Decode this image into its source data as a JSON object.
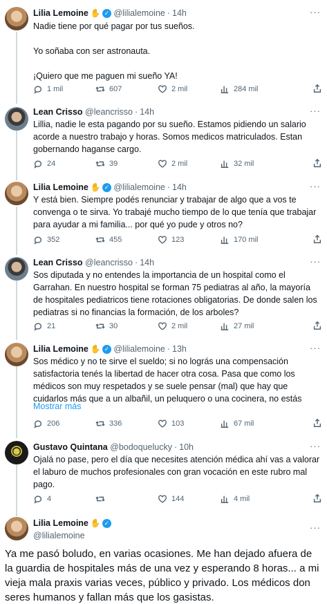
{
  "tweets": [
    {
      "name": "Lilia Lemoine",
      "handle": "@lilialemoine",
      "time": "14h",
      "text": "Nadie tiene por qué pagar por tus sueños.\n\nYo soñaba con ser astronauta.\n\n¡Quiero que me paguen mi sueño YA!",
      "replies": "1 mil",
      "retweets": "607",
      "likes": "2 mil",
      "views": "284 mil"
    },
    {
      "name": "Lean Crisso",
      "handle": "@leancrisso",
      "time": "14h",
      "text": "Lillia, nadie le esta pagando por su sueño. Estamos pidiendo un salario acorde a nuestro trabajo y horas. Somos medicos matriculados. Estan gobernando haganse cargo.",
      "replies": "24",
      "retweets": "39",
      "likes": "2 mil",
      "views": "32 mil"
    },
    {
      "name": "Lilia Lemoine",
      "handle": "@lilialemoine",
      "time": "14h",
      "text": "Y está bien. Siempre podés renunciar y trabajar de algo que a vos te convenga o te sirva. Yo trabajé mucho tiempo de lo que tenía que trabajar para ayudar a mi familia... por qué yo pude y otros no?",
      "replies": "352",
      "retweets": "455",
      "likes": "123",
      "views": "170 mil"
    },
    {
      "name": "Lean Crisso",
      "handle": "@leancrisso",
      "time": "14h",
      "text": "Sos diputada y no entendes la importancia de un hospital como el Garrahan. En nuestro hospital se forman 75 pediatras al año, la mayoría de hospitales pediatricos tiene rotaciones obligatorias. De donde salen los pediatras si no financias la formación, de los arboles?",
      "replies": "21",
      "retweets": "30",
      "likes": "2 mil",
      "views": "27 mil"
    },
    {
      "name": "Lilia Lemoine",
      "handle": "@lilialemoine",
      "time": "13h",
      "text": "Sos médico y no te sirve el sueldo; si no lográs una compensación satisfactoria tenés la libertad de hacer otra cosa. Pasa que como los médicos son muy respetados y se suele pensar (mal) que hay que cuidarlos más que a un albañil, un peluquero o una cocinera, no estás",
      "show_more": "Mostrar más",
      "replies": "206",
      "retweets": "336",
      "likes": "103",
      "views": "67 mil"
    },
    {
      "name": "Gustavo Quintana",
      "handle": "@bodoquelucky",
      "time": "10h",
      "text": "Ojalá no pase, pero el día que necesites atención médica ahí vas a valorar el laburo de muchos profesionales con gran vocación en este rubro mal pago.",
      "replies": "4",
      "retweets": "",
      "likes": "144",
      "views": "4 mil"
    }
  ],
  "main_tweet": {
    "name": "Lilia Lemoine",
    "handle": "@lilialemoine",
    "text": "Ya me pasó boludo, en varias ocasiones. Me han dejado afuera de la guardia de hospitales más de una vez y esperando 8 horas... a mi vieja mala praxis varias veces, público y privado. Los médicos don seres humanos y fallan más que los gasistas."
  },
  "separator": "·",
  "more_glyph": "···",
  "colors": {
    "accent": "#1d9bf0",
    "muted": "#536471",
    "text": "#0f1419"
  }
}
